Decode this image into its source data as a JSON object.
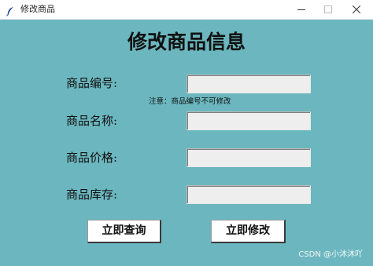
{
  "window": {
    "title": "修改商品",
    "icon": "feather-icon",
    "controls": [
      "minimize-icon",
      "maximize-icon",
      "close-icon"
    ]
  },
  "form": {
    "heading": "修改商品信息",
    "fields": [
      {
        "label": "商品编号:",
        "value": ""
      },
      {
        "label": "商品名称:",
        "value": ""
      },
      {
        "label": "商品价格:",
        "value": ""
      },
      {
        "label": "商品库存:",
        "value": ""
      }
    ],
    "note": "注意：商品编号不可修改"
  },
  "buttons": {
    "query": "立即查询",
    "modify": "立即修改"
  },
  "watermark": "CSDN @小沐沐吖",
  "colors": {
    "background": "#6cb7bf",
    "input_bg": "#eeeeee",
    "button_bg": "#ffffff"
  }
}
